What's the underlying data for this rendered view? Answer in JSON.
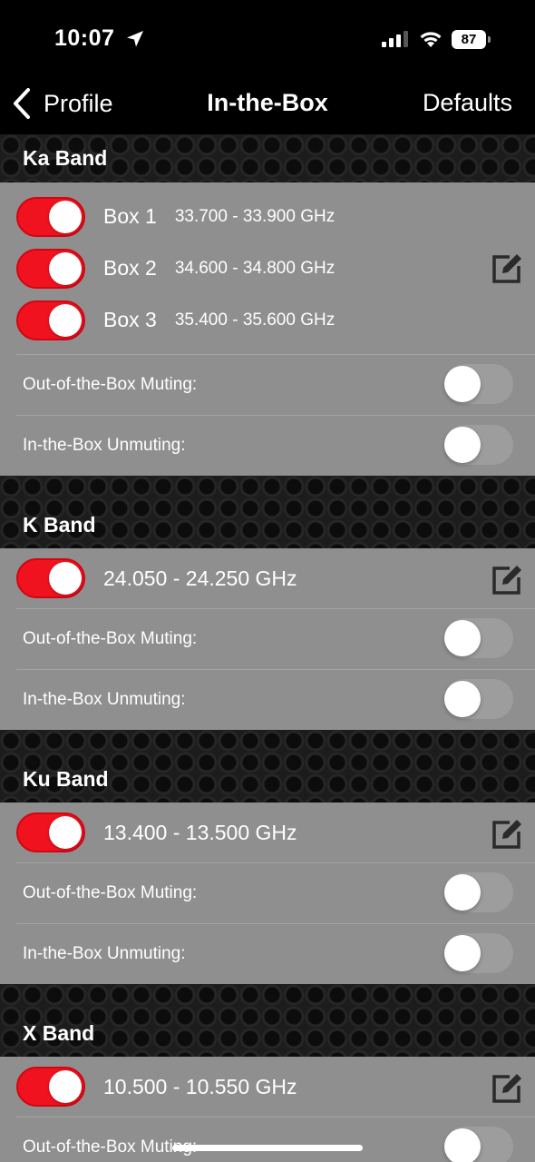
{
  "status_bar": {
    "time": "10:07",
    "battery": "87"
  },
  "nav": {
    "back_label": "Profile",
    "title": "In-the-Box",
    "right_label": "Defaults"
  },
  "option_labels": {
    "out_muting": "Out-of-the-Box Muting:",
    "in_unmuting": "In-the-Box Unmuting:"
  },
  "bands": [
    {
      "name": "Ka Band",
      "ranges": [
        {
          "label": "Box 1",
          "freq": "33.700 - 33.900 GHz",
          "enabled": true
        },
        {
          "label": "Box 2",
          "freq": "34.600 - 34.800 GHz",
          "enabled": true
        },
        {
          "label": "Box 3",
          "freq": "35.400 - 35.600 GHz",
          "enabled": true
        }
      ],
      "out_of_box_muting": false,
      "in_box_unmuting": false
    },
    {
      "name": "K Band",
      "ranges": [
        {
          "freq": "24.050 - 24.250 GHz",
          "enabled": true
        }
      ],
      "out_of_box_muting": false,
      "in_box_unmuting": false
    },
    {
      "name": "Ku Band",
      "ranges": [
        {
          "freq": "13.400 - 13.500 GHz",
          "enabled": true
        }
      ],
      "out_of_box_muting": false,
      "in_box_unmuting": false
    },
    {
      "name": "X Band",
      "ranges": [
        {
          "freq": "10.500 - 10.550 GHz",
          "enabled": true
        }
      ],
      "out_of_box_muting": false
    }
  ],
  "colors": {
    "toggle_on": "#f0131f",
    "panel": "#8f8f8f",
    "toggle_off": "#9d9d9d"
  },
  "icons": {
    "back": "chevron-left-icon",
    "edit": "edit-icon",
    "location": "location-arrow-icon"
  }
}
